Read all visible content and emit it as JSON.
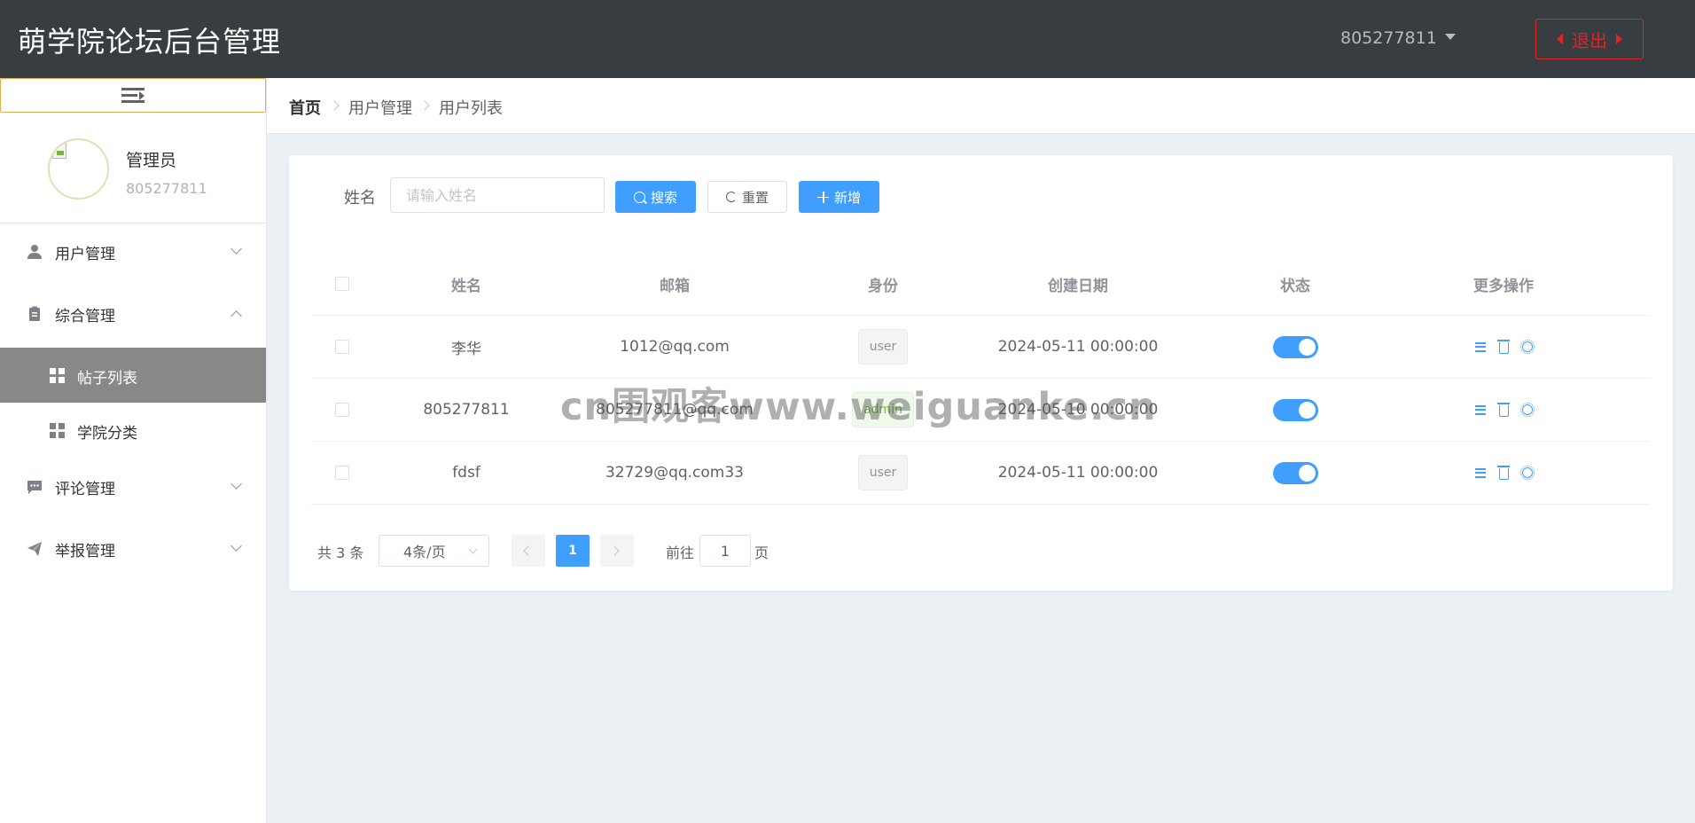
{
  "app": {
    "title": "萌学院论坛后台管理"
  },
  "header": {
    "username": "805277811",
    "logout_label": "退出"
  },
  "profile": {
    "role": "管理员",
    "uid": "805277811"
  },
  "sidebar": {
    "items": [
      {
        "label": "用户管理",
        "icon": "user-icon",
        "expanded": false
      },
      {
        "label": "综合管理",
        "icon": "clipboard-icon",
        "expanded": true,
        "children": [
          {
            "label": "帖子列表",
            "icon": "grid-icon",
            "active": true
          },
          {
            "label": "学院分类",
            "icon": "grid-icon",
            "active": false
          }
        ]
      },
      {
        "label": "评论管理",
        "icon": "comment-icon",
        "expanded": false
      },
      {
        "label": "举报管理",
        "icon": "send-icon",
        "expanded": false
      }
    ]
  },
  "breadcrumb": [
    "首页",
    "用户管理",
    "用户列表"
  ],
  "filter": {
    "name_label": "姓名",
    "name_placeholder": "请输入姓名",
    "name_value": "",
    "search_label": "搜索",
    "reset_label": "重置",
    "add_label": "新增"
  },
  "table": {
    "columns": [
      "姓名",
      "邮箱",
      "身份",
      "创建日期",
      "状态",
      "更多操作"
    ],
    "rows": [
      {
        "name": "李华",
        "email": "1012@qq.com",
        "role": "user",
        "created": "2024-05-11 00:00:00",
        "enabled": true
      },
      {
        "name": "805277811",
        "email": "805277811@qq.com",
        "role": "admin",
        "created": "2024-05-10 00:00:00",
        "enabled": true
      },
      {
        "name": "fdsf",
        "email": "32729@qq.com33",
        "role": "user",
        "created": "2024-05-11 00:00:00",
        "enabled": true
      }
    ]
  },
  "pagination": {
    "total_label": "共 3 条",
    "page_size": "4条/页",
    "current_page": "1",
    "goto_prefix": "前往",
    "goto_value": "1",
    "goto_suffix": "页"
  },
  "watermark": "cn围观客www.weiguanke.cn",
  "colors": {
    "header_bg": "#373d41",
    "primary": "#409eff",
    "danger": "#e02424",
    "active_menu_bg": "#888888",
    "page_bg": "#eaf0f4"
  }
}
